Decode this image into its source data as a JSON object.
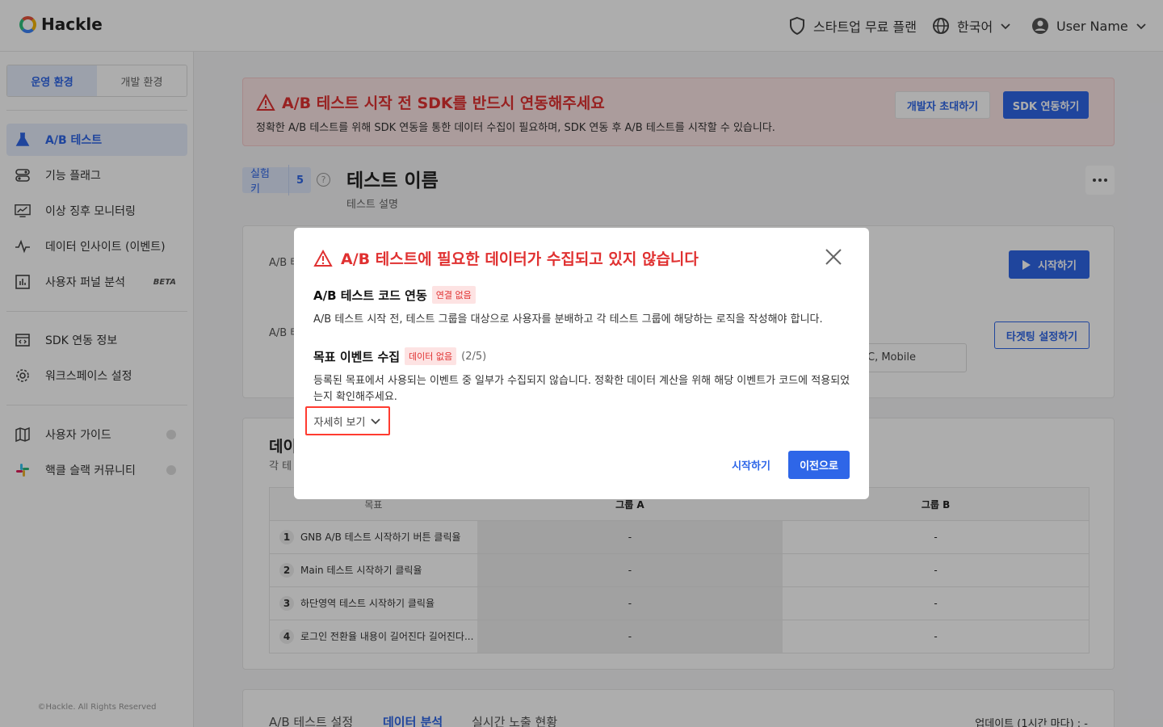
{
  "header": {
    "logo_text": "Hackle",
    "plan_label": "스타트업 무료 플랜",
    "language_label": "한국어",
    "user_name": "User Name"
  },
  "sidebar": {
    "env_tabs": [
      {
        "label": "운영 환경",
        "active": true
      },
      {
        "label": "개발 환경",
        "active": false
      }
    ],
    "items": [
      {
        "label": "A/B 테스트",
        "icon": "flask-icon",
        "active": true
      },
      {
        "label": "기능 플래그",
        "icon": "toggle-icon"
      },
      {
        "label": "이상 징후 모니터링",
        "icon": "monitor-chart-icon"
      },
      {
        "label": "데이터 인사이트 (이벤트)",
        "icon": "pulse-icon"
      },
      {
        "label": "사용자 퍼널 분석",
        "icon": "bar-chart-icon",
        "badge": "BETA"
      },
      {
        "label": "SDK 연동 정보",
        "icon": "code-window-icon"
      },
      {
        "label": "워크스페이스 설정",
        "icon": "gear-icon"
      },
      {
        "label": "사용자 가이드",
        "icon": "map-icon"
      },
      {
        "label": "핵클 슬랙 커뮤니티",
        "icon": "slack-icon"
      }
    ],
    "copyright": "©Hackle. All Rights Reserved"
  },
  "alert": {
    "title": "A/B 테스트 시작 전 SDK를 반드시 연동해주세요",
    "description": "정확한 A/B 테스트를 위해 SDK 연동을 통한 데이터 수집이 필요하며, SDK 연동 후 A/B 테스트를 시작할 수 있습니다.",
    "invite_button": "개발자 초대하기",
    "sdk_button": "SDK 연동하기"
  },
  "experiment": {
    "key_label": "실험 키",
    "key_value": "5",
    "title": "테스트 이름",
    "description": "테스트 설명",
    "start_button": "시작하기",
    "targeting_button": "타겟팅 설정하기",
    "row1_label": "A/B 테",
    "row2_label": "A/B 테",
    "platform_value": "C, Mobile"
  },
  "data_section": {
    "title": "데이",
    "subtitle": "각 테",
    "columns": [
      "목표",
      "그룹 A",
      "그룹 B"
    ],
    "rows": [
      {
        "no": "1",
        "name": "GNB A/B 테스트 시작하기 버튼 클릭율",
        "a": "-",
        "b": "-"
      },
      {
        "no": "2",
        "name": "Main 테스트 시작하기 클릭율",
        "a": "-",
        "b": "-"
      },
      {
        "no": "3",
        "name": "하단영역 테스트 시작하기 클릭율",
        "a": "-",
        "b": "-"
      },
      {
        "no": "4",
        "name": "로그인 전환율 내용이 길어진다 길어진다...",
        "a": "-",
        "b": "-"
      }
    ]
  },
  "bottom_tabs": {
    "items": [
      "A/B 테스트 설정",
      "데이터 분석",
      "실시간 노출 현황"
    ],
    "active_index": 1,
    "update_text": "업데이트 (1시간 마다) : -"
  },
  "modal": {
    "title": "A/B 테스트에 필요한 데이터가 수집되고 있지 않습니다",
    "section1_title": "A/B 테스트 코드 연동",
    "section1_tag": "연결 없음",
    "section1_desc": "A/B 테스트 시작 전, 테스트 그룹을 대상으로 사용자를 분배하고 각 테스트 그룹에 해당하는 로직을 작성해야 합니다.",
    "section2_title": "목표 이벤트 수집",
    "section2_tag": "데이터 없음",
    "section2_count": "(2/5)",
    "section2_desc": "등록된 목표에서 사용되는 이벤트 중 일부가 수집되지 않습니다. 정확한 데이터 계산을 위해 해당 이벤트가 코드에 적용되었는지 확인해주세요.",
    "details_label": "자세히 보기",
    "start_button": "시작하기",
    "back_button": "이전으로"
  },
  "colors": {
    "primary": "#2e66e8",
    "danger": "#e03131",
    "highlight": "#ff3b30"
  }
}
